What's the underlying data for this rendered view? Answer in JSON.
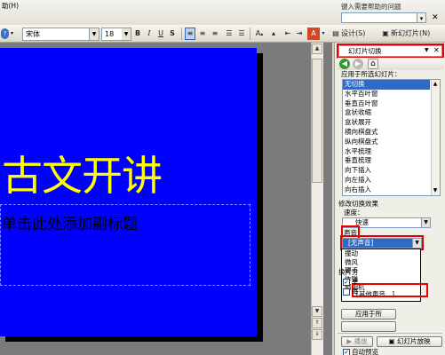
{
  "menubar": {
    "fragment": "助(H)",
    "help_placeholder": "键入需要帮助的问题"
  },
  "toolbar": {
    "font_name": "宋体",
    "font_size": "18",
    "bold": "B",
    "italic": "I",
    "underline": "U",
    "shadow": "S",
    "font_grow": "A",
    "design_label": "设计(S)",
    "new_slide_label": "新幻灯片(N)"
  },
  "slide": {
    "title": "古文开讲",
    "subtitle": "单击此处添加副标题"
  },
  "task_pane": {
    "title": "幻灯片切换",
    "apply_label": "应用于所选幻灯片：",
    "effects": [
      "无切换",
      "水平百叶窗",
      "垂直百叶窗",
      "盒状收缩",
      "盒状展开",
      "横向棋盘式",
      "纵向棋盘式",
      "水平梳理",
      "垂直梳理",
      "向下插入",
      "向左插入",
      "向右插入"
    ],
    "selected_effect": "无切换",
    "modify_label": "修改切换效果",
    "speed_label": "速度：",
    "speed_value": "快速",
    "sound_label": "声音：",
    "sound_value": "[无声音]",
    "sound_options": [
      "撞动",
      "微风",
      "硬币",
      "炸弹",
      "照相机"
    ],
    "sound_selected": "[其他声音...]",
    "switch_label": "换片方",
    "check1": "单",
    "check2": "每",
    "apply_all_label": "应用于所",
    "play_label": "播放",
    "slideshow_label": "幻灯片放映",
    "autopreview_label": "自动预览"
  }
}
